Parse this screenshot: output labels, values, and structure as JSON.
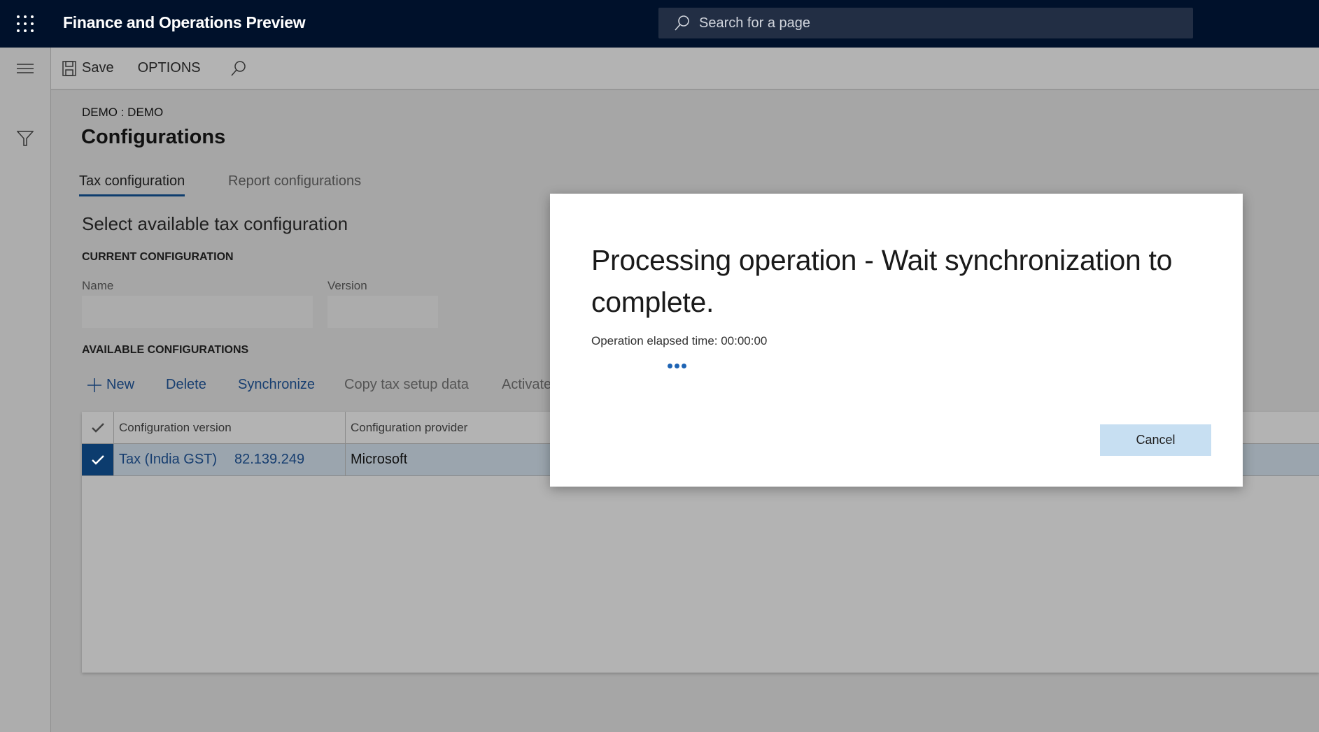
{
  "header": {
    "app_title": "Finance and Operations Preview",
    "search_placeholder": "Search for a page"
  },
  "toolbar": {
    "save_label": "Save",
    "options_label": "OPTIONS"
  },
  "page": {
    "breadcrumb": "DEMO : DEMO",
    "title": "Configurations",
    "tabs": [
      {
        "label": "Tax configuration",
        "active": true
      },
      {
        "label": "Report configurations",
        "active": false
      }
    ],
    "section_title": "Select available tax configuration",
    "current_configuration": {
      "heading": "CURRENT CONFIGURATION",
      "name_label": "Name",
      "name_value": "",
      "version_label": "Version",
      "version_value": ""
    },
    "available": {
      "heading": "AVAILABLE CONFIGURATIONS",
      "actions": [
        "New",
        "Delete",
        "Synchronize",
        "Copy tax setup data",
        "Activate"
      ],
      "columns": [
        "Configuration version",
        "Configuration provider"
      ],
      "rows": [
        {
          "name": "Tax (India GST)",
          "version": "82.139.249",
          "provider": "Microsoft",
          "selected": true
        }
      ]
    }
  },
  "dialog": {
    "title": "Processing operation - Wait synchronization to complete.",
    "elapsed": "Operation elapsed time: 00:00:00",
    "cancel_label": "Cancel"
  },
  "colors": {
    "topbar": "#00112b",
    "accent": "#0e3d6e",
    "dots": "#1e64b4"
  }
}
